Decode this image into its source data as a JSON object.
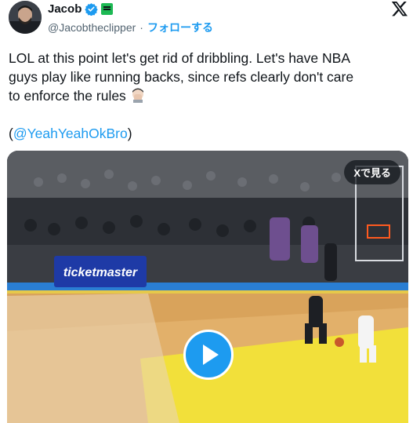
{
  "author": {
    "display_name": "Jacob",
    "handle": "@Jacobtheclipper",
    "separator": "·",
    "follow_label": "フォローする",
    "verified_icon": "verified-badge-icon",
    "affiliation_icon": "affiliation-badge-icon"
  },
  "tweet": {
    "text_lines": [
      "LOL at this point let's get rid of dribbling. Let's have NBA",
      "guys play like running backs, since refs clearly don't care",
      "to enforce the rules"
    ],
    "emoji": "facepalm",
    "mention_open": "(",
    "mention": "@YeahYeahOkBro",
    "mention_close": ")"
  },
  "media": {
    "view_on_x_label": "Xで見る",
    "banner_text": "ticketmaster",
    "play_icon": "play-icon"
  },
  "colors": {
    "accent": "#1d9bf0",
    "text": "#0f1419",
    "muted": "#536471"
  }
}
